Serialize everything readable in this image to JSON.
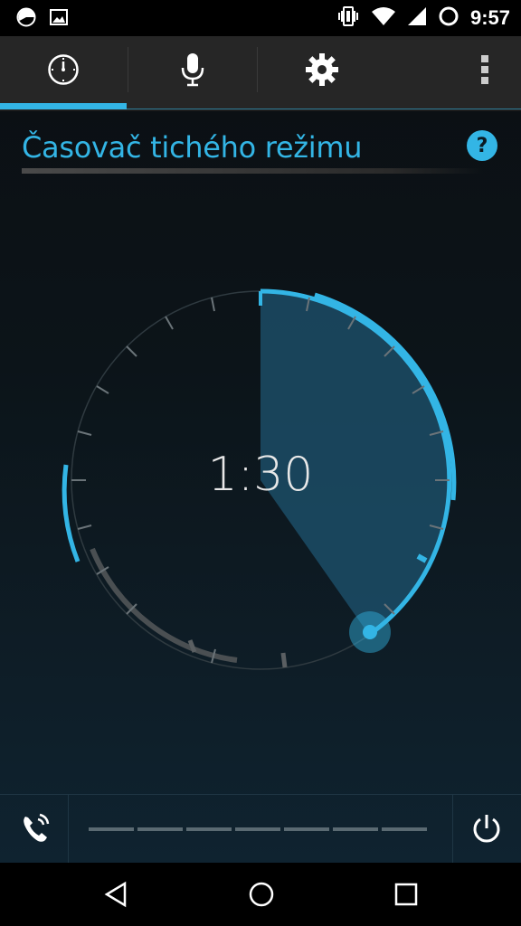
{
  "status_bar": {
    "time": "9:57",
    "icons": [
      "clock-icon",
      "image-icon",
      "vibrate-icon",
      "wifi-icon",
      "signal-icon",
      "circle-icon"
    ]
  },
  "tabs": [
    {
      "name": "timer",
      "icon": "clock-icon",
      "selected": true
    },
    {
      "name": "voice",
      "icon": "microphone-icon",
      "selected": false
    },
    {
      "name": "settings",
      "icon": "gear-icon",
      "selected": false
    }
  ],
  "header": {
    "title": "Časovač tichého režimu",
    "help_label": "?"
  },
  "timer": {
    "value": "1:30"
  },
  "colors": {
    "accent": "#33b5e5",
    "tab_bg": "#262626",
    "dim_tick": "#5a5a5a"
  },
  "bottom_bar": {
    "left_icon": "phone-icon",
    "right_icon": "power-icon"
  },
  "nav_bar": [
    "back-icon",
    "home-icon",
    "recents-icon"
  ]
}
